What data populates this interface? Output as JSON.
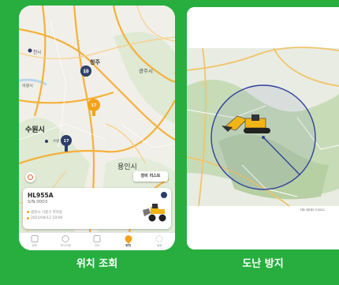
{
  "panels": {
    "location": {
      "caption": "위치 조회",
      "map_labels": {
        "city_cheongju": "청주",
        "city_gwangju": "광주시",
        "city_suwon": "수원시",
        "city_yongin": "용인시",
        "district_uiwang": "의왕시",
        "district_cheonan": "천시",
        "district_suwon_small": "수원"
      },
      "markers": [
        {
          "count": "10",
          "color": "#2c3e6b"
        },
        {
          "count": "17",
          "color": "#f2a21d"
        },
        {
          "count": "17",
          "color": "#2c3e6b"
        }
      ],
      "list_button": "장비 리스트",
      "card": {
        "model": "HL955A",
        "serial": "S/N 0003",
        "address": "광진시 기흥구 마북동",
        "datetime": "2021/04/12 19:00"
      },
      "tabs": [
        {
          "label": "장비",
          "icon": "equipment-icon"
        },
        {
          "label": "모니터링",
          "icon": "gauge-icon"
        },
        {
          "label": "관리",
          "icon": "doc-icon"
        },
        {
          "label": "위치",
          "icon": "location-pin-icon",
          "active": true
        },
        {
          "label": "설정",
          "icon": "gear-icon"
        }
      ]
    },
    "theft": {
      "caption": "도난 방지",
      "attribution": "지도 데이터 ©2021"
    }
  },
  "colors": {
    "background": "#27ae3f",
    "accent": "#f2a21d",
    "marker_dark": "#2c3e6b",
    "geofence": "#2e3f9e"
  }
}
